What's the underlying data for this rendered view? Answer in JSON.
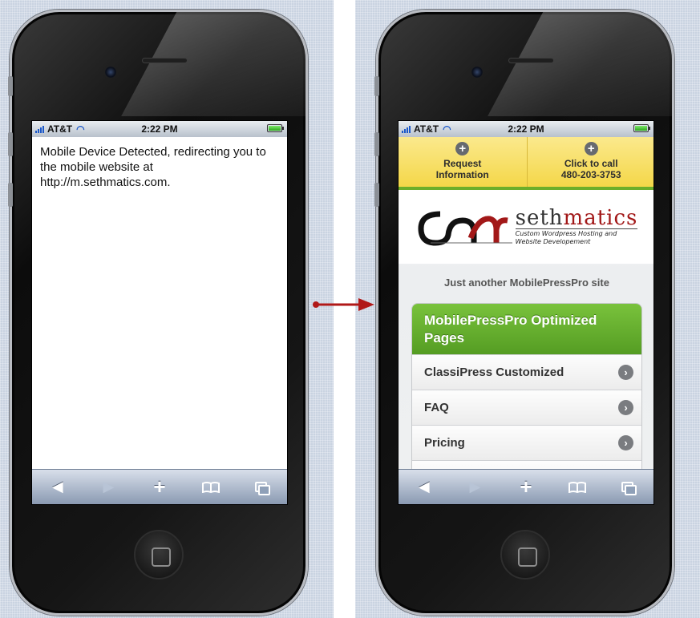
{
  "left_phone": {
    "status": {
      "carrier": "AT&T",
      "time": "2:22 PM"
    },
    "message": "Mobile Device Detected, redirecting you to the mobile website at http://m.sethmatics.com."
  },
  "right_phone": {
    "status": {
      "carrier": "AT&T",
      "time": "2:22 PM"
    },
    "actions": [
      {
        "line1": "Request",
        "line2": "Information"
      },
      {
        "line1": "Click to call",
        "line2": "480-203-3753"
      }
    ],
    "logo": {
      "brand_prefix": "seth",
      "brand_suffix": "matics",
      "tag1": "Custom Wordpress Hosting and",
      "tag2": "Website Developement"
    },
    "tagline": "Just another MobilePressPro site",
    "menu": {
      "header": "MobilePressPro Optimized Pages",
      "items": [
        "ClassiPress Customized",
        "FAQ",
        "Pricing"
      ]
    }
  },
  "toolbar_icons": [
    "back-icon",
    "forward-icon",
    "add-icon",
    "bookmarks-icon",
    "tabs-icon"
  ],
  "colors": {
    "accent_green": "#6cae2a",
    "action_yellow": "#f4d748",
    "brand_red": "#a21818",
    "arrow_red": "#b01818"
  }
}
